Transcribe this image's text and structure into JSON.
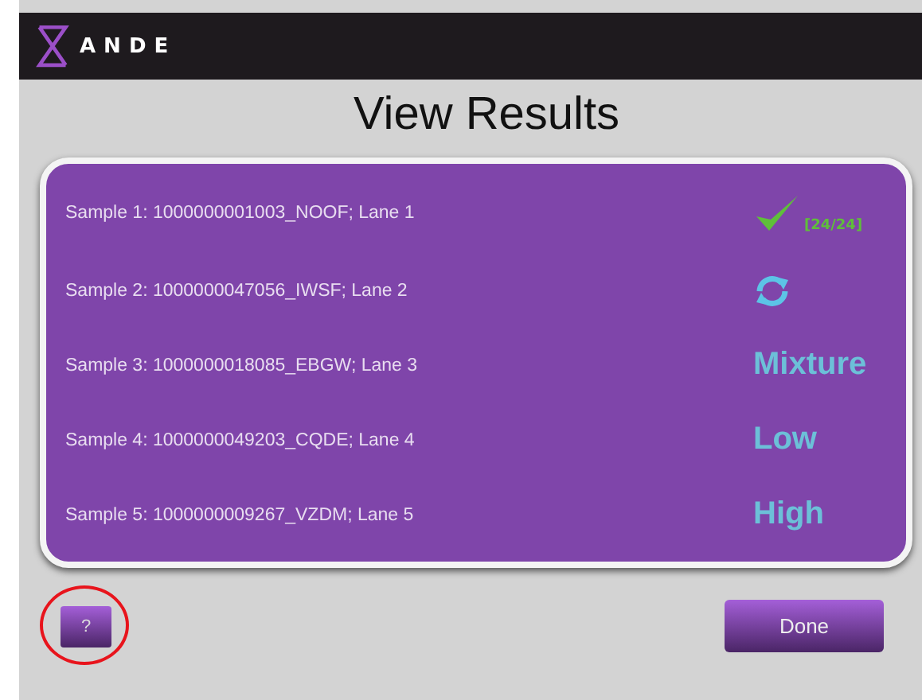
{
  "header": {
    "logo_text": "ANDE"
  },
  "title": "View Results",
  "samples": [
    {
      "label": "Sample 1: 1000000001003_NOOF; Lane 1",
      "result": {
        "kind": "pass",
        "text": "[24/24]"
      }
    },
    {
      "label": "Sample 2: 1000000047056_IWSF; Lane 2",
      "result": {
        "kind": "retry"
      }
    },
    {
      "label": "Sample 3: 1000000018085_EBGW; Lane 3",
      "result": {
        "kind": "text",
        "text": "Mixture"
      }
    },
    {
      "label": "Sample 4: 1000000049203_CQDE; Lane 4",
      "result": {
        "kind": "text",
        "text": "Low"
      }
    },
    {
      "label": "Sample 5: 1000000009267_VZDM; Lane 5",
      "result": {
        "kind": "text",
        "text": "High"
      }
    }
  ],
  "help_button": {
    "label": "?",
    "highlighted": true
  },
  "done_button": {
    "label": "Done"
  }
}
